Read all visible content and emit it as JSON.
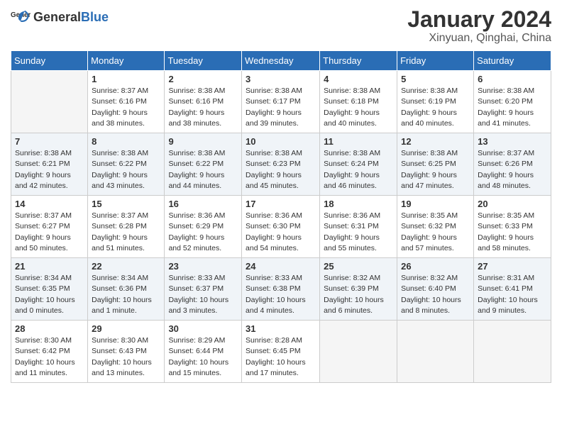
{
  "header": {
    "logo_general": "General",
    "logo_blue": "Blue",
    "main_title": "January 2024",
    "subtitle": "Xinyuan, Qinghai, China"
  },
  "calendar": {
    "days_of_week": [
      "Sunday",
      "Monday",
      "Tuesday",
      "Wednesday",
      "Thursday",
      "Friday",
      "Saturday"
    ],
    "weeks": [
      [
        {
          "day": "",
          "sunrise": "",
          "sunset": "",
          "daylight": "",
          "empty": true
        },
        {
          "day": "1",
          "sunrise": "Sunrise: 8:37 AM",
          "sunset": "Sunset: 6:16 PM",
          "daylight": "Daylight: 9 hours and 38 minutes.",
          "empty": false
        },
        {
          "day": "2",
          "sunrise": "Sunrise: 8:38 AM",
          "sunset": "Sunset: 6:16 PM",
          "daylight": "Daylight: 9 hours and 38 minutes.",
          "empty": false
        },
        {
          "day": "3",
          "sunrise": "Sunrise: 8:38 AM",
          "sunset": "Sunset: 6:17 PM",
          "daylight": "Daylight: 9 hours and 39 minutes.",
          "empty": false
        },
        {
          "day": "4",
          "sunrise": "Sunrise: 8:38 AM",
          "sunset": "Sunset: 6:18 PM",
          "daylight": "Daylight: 9 hours and 40 minutes.",
          "empty": false
        },
        {
          "day": "5",
          "sunrise": "Sunrise: 8:38 AM",
          "sunset": "Sunset: 6:19 PM",
          "daylight": "Daylight: 9 hours and 40 minutes.",
          "empty": false
        },
        {
          "day": "6",
          "sunrise": "Sunrise: 8:38 AM",
          "sunset": "Sunset: 6:20 PM",
          "daylight": "Daylight: 9 hours and 41 minutes.",
          "empty": false
        }
      ],
      [
        {
          "day": "7",
          "sunrise": "Sunrise: 8:38 AM",
          "sunset": "Sunset: 6:21 PM",
          "daylight": "Daylight: 9 hours and 42 minutes.",
          "empty": false
        },
        {
          "day": "8",
          "sunrise": "Sunrise: 8:38 AM",
          "sunset": "Sunset: 6:22 PM",
          "daylight": "Daylight: 9 hours and 43 minutes.",
          "empty": false
        },
        {
          "day": "9",
          "sunrise": "Sunrise: 8:38 AM",
          "sunset": "Sunset: 6:22 PM",
          "daylight": "Daylight: 9 hours and 44 minutes.",
          "empty": false
        },
        {
          "day": "10",
          "sunrise": "Sunrise: 8:38 AM",
          "sunset": "Sunset: 6:23 PM",
          "daylight": "Daylight: 9 hours and 45 minutes.",
          "empty": false
        },
        {
          "day": "11",
          "sunrise": "Sunrise: 8:38 AM",
          "sunset": "Sunset: 6:24 PM",
          "daylight": "Daylight: 9 hours and 46 minutes.",
          "empty": false
        },
        {
          "day": "12",
          "sunrise": "Sunrise: 8:38 AM",
          "sunset": "Sunset: 6:25 PM",
          "daylight": "Daylight: 9 hours and 47 minutes.",
          "empty": false
        },
        {
          "day": "13",
          "sunrise": "Sunrise: 8:37 AM",
          "sunset": "Sunset: 6:26 PM",
          "daylight": "Daylight: 9 hours and 48 minutes.",
          "empty": false
        }
      ],
      [
        {
          "day": "14",
          "sunrise": "Sunrise: 8:37 AM",
          "sunset": "Sunset: 6:27 PM",
          "daylight": "Daylight: 9 hours and 50 minutes.",
          "empty": false
        },
        {
          "day": "15",
          "sunrise": "Sunrise: 8:37 AM",
          "sunset": "Sunset: 6:28 PM",
          "daylight": "Daylight: 9 hours and 51 minutes.",
          "empty": false
        },
        {
          "day": "16",
          "sunrise": "Sunrise: 8:36 AM",
          "sunset": "Sunset: 6:29 PM",
          "daylight": "Daylight: 9 hours and 52 minutes.",
          "empty": false
        },
        {
          "day": "17",
          "sunrise": "Sunrise: 8:36 AM",
          "sunset": "Sunset: 6:30 PM",
          "daylight": "Daylight: 9 hours and 54 minutes.",
          "empty": false
        },
        {
          "day": "18",
          "sunrise": "Sunrise: 8:36 AM",
          "sunset": "Sunset: 6:31 PM",
          "daylight": "Daylight: 9 hours and 55 minutes.",
          "empty": false
        },
        {
          "day": "19",
          "sunrise": "Sunrise: 8:35 AM",
          "sunset": "Sunset: 6:32 PM",
          "daylight": "Daylight: 9 hours and 57 minutes.",
          "empty": false
        },
        {
          "day": "20",
          "sunrise": "Sunrise: 8:35 AM",
          "sunset": "Sunset: 6:33 PM",
          "daylight": "Daylight: 9 hours and 58 minutes.",
          "empty": false
        }
      ],
      [
        {
          "day": "21",
          "sunrise": "Sunrise: 8:34 AM",
          "sunset": "Sunset: 6:35 PM",
          "daylight": "Daylight: 10 hours and 0 minutes.",
          "empty": false
        },
        {
          "day": "22",
          "sunrise": "Sunrise: 8:34 AM",
          "sunset": "Sunset: 6:36 PM",
          "daylight": "Daylight: 10 hours and 1 minute.",
          "empty": false
        },
        {
          "day": "23",
          "sunrise": "Sunrise: 8:33 AM",
          "sunset": "Sunset: 6:37 PM",
          "daylight": "Daylight: 10 hours and 3 minutes.",
          "empty": false
        },
        {
          "day": "24",
          "sunrise": "Sunrise: 8:33 AM",
          "sunset": "Sunset: 6:38 PM",
          "daylight": "Daylight: 10 hours and 4 minutes.",
          "empty": false
        },
        {
          "day": "25",
          "sunrise": "Sunrise: 8:32 AM",
          "sunset": "Sunset: 6:39 PM",
          "daylight": "Daylight: 10 hours and 6 minutes.",
          "empty": false
        },
        {
          "day": "26",
          "sunrise": "Sunrise: 8:32 AM",
          "sunset": "Sunset: 6:40 PM",
          "daylight": "Daylight: 10 hours and 8 minutes.",
          "empty": false
        },
        {
          "day": "27",
          "sunrise": "Sunrise: 8:31 AM",
          "sunset": "Sunset: 6:41 PM",
          "daylight": "Daylight: 10 hours and 9 minutes.",
          "empty": false
        }
      ],
      [
        {
          "day": "28",
          "sunrise": "Sunrise: 8:30 AM",
          "sunset": "Sunset: 6:42 PM",
          "daylight": "Daylight: 10 hours and 11 minutes.",
          "empty": false
        },
        {
          "day": "29",
          "sunrise": "Sunrise: 8:30 AM",
          "sunset": "Sunset: 6:43 PM",
          "daylight": "Daylight: 10 hours and 13 minutes.",
          "empty": false
        },
        {
          "day": "30",
          "sunrise": "Sunrise: 8:29 AM",
          "sunset": "Sunset: 6:44 PM",
          "daylight": "Daylight: 10 hours and 15 minutes.",
          "empty": false
        },
        {
          "day": "31",
          "sunrise": "Sunrise: 8:28 AM",
          "sunset": "Sunset: 6:45 PM",
          "daylight": "Daylight: 10 hours and 17 minutes.",
          "empty": false
        },
        {
          "day": "",
          "sunrise": "",
          "sunset": "",
          "daylight": "",
          "empty": true
        },
        {
          "day": "",
          "sunrise": "",
          "sunset": "",
          "daylight": "",
          "empty": true
        },
        {
          "day": "",
          "sunrise": "",
          "sunset": "",
          "daylight": "",
          "empty": true
        }
      ]
    ]
  }
}
